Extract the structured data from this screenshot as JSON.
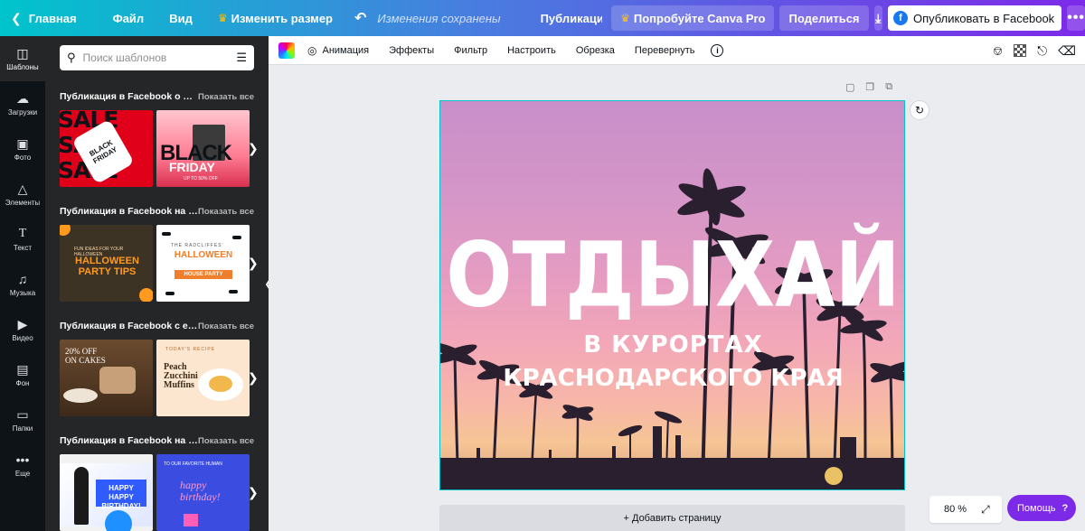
{
  "topbar": {
    "home": "Главная",
    "file": "Файл",
    "view": "Вид",
    "resize": "Изменить размер",
    "saved": "Изменения сохранены",
    "doc_title": "Публикация в социальных сетях с фотог...",
    "try_pro": "Попробуйте Canva Pro",
    "share": "Поделиться",
    "publish": "Опубликовать в Facebook"
  },
  "rail": [
    {
      "label": "Шаблоны",
      "icon": "templates-icon"
    },
    {
      "label": "Загрузки",
      "icon": "upload-icon"
    },
    {
      "label": "Фото",
      "icon": "photo-icon"
    },
    {
      "label": "Элементы",
      "icon": "elements-icon"
    },
    {
      "label": "Текст",
      "icon": "text-icon"
    },
    {
      "label": "Музыка",
      "icon": "music-icon"
    },
    {
      "label": "Видео",
      "icon": "video-icon"
    },
    {
      "label": "Фон",
      "icon": "background-icon"
    },
    {
      "label": "Папки",
      "icon": "folder-icon"
    },
    {
      "label": "Еще",
      "icon": "more-icon"
    }
  ],
  "panel": {
    "search_placeholder": "Поиск шаблонов",
    "show_all": "Показать все",
    "sections": [
      {
        "title": "Публикация в Facebook о ра...",
        "thumbs": [
          {
            "lines": [
              "SALE",
              "SALE",
              "SALE"
            ],
            "tag": "BLACK FRIDAY",
            "tag_small": "%"
          },
          {
            "big": "BLACK",
            "word": "FRIDAY",
            "small": "UP TO 50% OFF"
          }
        ]
      },
      {
        "title": "Публикация в Facebook на Х...",
        "thumbs": [
          {
            "text": "HALLOWEEN PARTY TIPS",
            "small": "FUN IDEAS FOR YOUR HALLOWEEN"
          },
          {
            "text": "HALLOWEEN",
            "sub": "HOUSE PARTY",
            "small": "THE RADCLIFFES'"
          }
        ]
      },
      {
        "title": "Публикация в Facebook с едой",
        "thumbs": [
          {
            "text": "20% OFF ON CAKES"
          },
          {
            "text": "Peach Zucchini Muffins",
            "small": "TODAY'S RECIPE"
          }
        ]
      },
      {
        "title": "Публикация в Facebook на д...",
        "thumbs": [
          {
            "text": "HAPPY HAPPY BIRTHDAY!"
          },
          {
            "text": "happy birthday!",
            "small": "TO OUR FAVORITE HUMAN"
          }
        ]
      }
    ]
  },
  "context_toolbar": {
    "animation": "Анимация",
    "effects": "Эффекты",
    "filter": "Фильтр",
    "adjust": "Настроить",
    "crop": "Обрезка",
    "flip": "Перевернуть",
    "info": "i"
  },
  "design": {
    "title": "ОТДЫХАЙ",
    "subtitle1": "В КУРОРТАХ",
    "subtitle2": "КРАСНОДАРСКОГО КРАЯ"
  },
  "add_page": "+ Добавить страницу",
  "zoom": "80 %",
  "help": "Помощь",
  "help_q": "?",
  "colors": {
    "brand_purple": "#7d2ae8",
    "brand_teal": "#00c4cc",
    "panel_bg": "#252627",
    "rail_bg": "#0e1318"
  }
}
